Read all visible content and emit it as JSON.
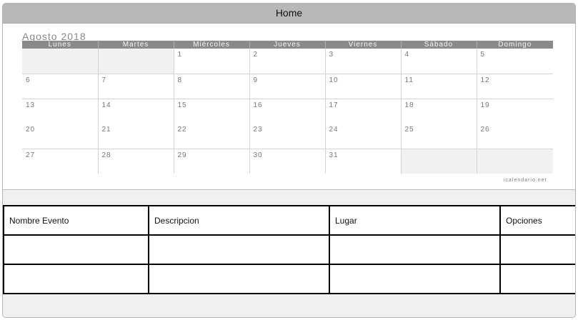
{
  "header": {
    "title": "Home"
  },
  "calendar": {
    "month_title": "Agosto 2018",
    "weekdays": [
      "Lunes",
      "Martes",
      "Miércoles",
      "Jueves",
      "Viernes",
      "Sábado",
      "Domingo"
    ],
    "weeks": [
      [
        "",
        "",
        "1",
        "2",
        "3",
        "4",
        "5"
      ],
      [
        "6",
        "7",
        "8",
        "9",
        "10",
        "11",
        "12"
      ],
      [
        "13",
        "14",
        "15",
        "16",
        "17",
        "18",
        "19"
      ],
      [
        "20",
        "21",
        "22",
        "23",
        "24",
        "25",
        "26"
      ],
      [
        "27",
        "28",
        "29",
        "30",
        "31",
        "",
        ""
      ]
    ],
    "credit": "icalendario.net"
  },
  "events_table": {
    "columns": [
      "Nombre Evento",
      "Descripcion",
      "Lugar",
      "Opciones"
    ],
    "rows": [
      [
        "",
        "",
        "",
        ""
      ],
      [
        "",
        "",
        "",
        ""
      ]
    ]
  }
}
